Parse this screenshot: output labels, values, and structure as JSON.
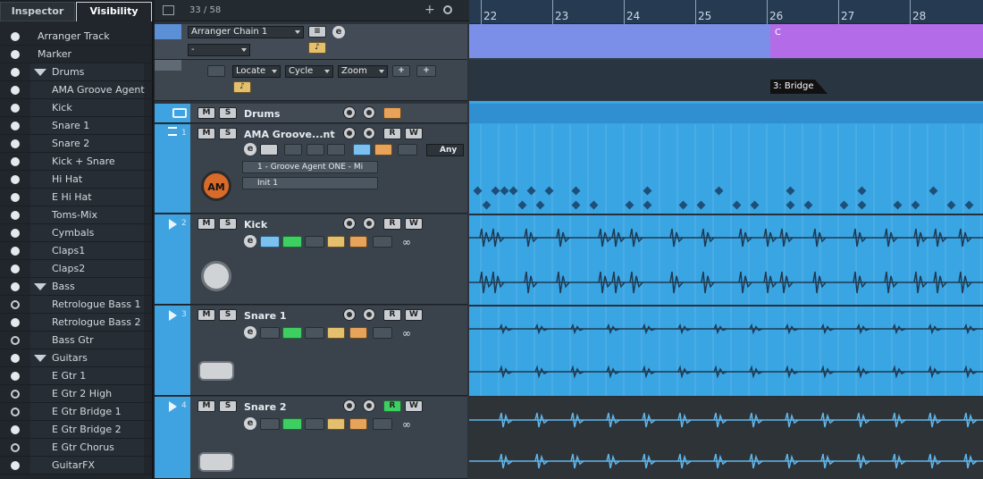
{
  "tabs": {
    "inspector": "Inspector",
    "visibility": "Visibility"
  },
  "visibility": [
    {
      "label": "Arranger Track",
      "level": 0,
      "dot": "filled"
    },
    {
      "label": "Marker",
      "level": 0,
      "dot": "filled"
    },
    {
      "label": "Drums",
      "level": 1,
      "dot": "filled",
      "folder": true
    },
    {
      "label": "AMA Groove Agent",
      "level": 2,
      "dot": "filled"
    },
    {
      "label": "Kick",
      "level": 2,
      "dot": "filled"
    },
    {
      "label": "Snare 1",
      "level": 2,
      "dot": "filled"
    },
    {
      "label": "Snare 2",
      "level": 2,
      "dot": "filled"
    },
    {
      "label": "Kick + Snare",
      "level": 2,
      "dot": "filled"
    },
    {
      "label": "Hi Hat",
      "level": 2,
      "dot": "filled"
    },
    {
      "label": "E Hi Hat",
      "level": 2,
      "dot": "filled"
    },
    {
      "label": "Toms-Mix",
      "level": 2,
      "dot": "filled"
    },
    {
      "label": "Cymbals",
      "level": 2,
      "dot": "filled"
    },
    {
      "label": "Claps1",
      "level": 2,
      "dot": "filled"
    },
    {
      "label": "Claps2",
      "level": 2,
      "dot": "filled"
    },
    {
      "label": "Bass",
      "level": 1,
      "dot": "filled",
      "folder": true
    },
    {
      "label": "Retrologue Bass 1",
      "level": 2,
      "dot": "hollow"
    },
    {
      "label": "Retrologue Bass 2",
      "level": 2,
      "dot": "filled"
    },
    {
      "label": "Bass Gtr",
      "level": 2,
      "dot": "hollow"
    },
    {
      "label": "Guitars",
      "level": 1,
      "dot": "filled",
      "folder": true
    },
    {
      "label": "E Gtr 1",
      "level": 2,
      "dot": "filled"
    },
    {
      "label": "E Gtr 2 High",
      "level": 2,
      "dot": "hollow"
    },
    {
      "label": "E Gtr Bridge 1",
      "level": 2,
      "dot": "hollow"
    },
    {
      "label": "E Gtr Bridge 2",
      "level": 2,
      "dot": "filled"
    },
    {
      "label": "E Gtr Chorus",
      "level": 2,
      "dot": "hollow"
    },
    {
      "label": "GuitarFX",
      "level": 2,
      "dot": "filled"
    }
  ],
  "header": {
    "track_count": "33 / 58",
    "plus": "+"
  },
  "arranger": {
    "chain": "Arranger Chain 1",
    "dash": "-"
  },
  "chain_row": {
    "locate": "Locate",
    "cycle": "Cycle",
    "zoom": "Zoom"
  },
  "tracks": {
    "drums": {
      "name": "Drums"
    },
    "ama": {
      "num": "1",
      "name": "AMA Groove...nt",
      "any": "Any",
      "instrument": "1 - Groove Agent ONE - Mi",
      "preset": "Init 1",
      "logo": "AM"
    },
    "kick": {
      "num": "2",
      "name": "Kick"
    },
    "snare1": {
      "num": "3",
      "name": "Snare 1"
    },
    "snare2": {
      "num": "4",
      "name": "Snare 2"
    }
  },
  "buttons": {
    "m": "M",
    "s": "S",
    "r": "R",
    "w": "W",
    "e": "e"
  },
  "ruler": {
    "bars": [
      "22",
      "23",
      "24",
      "25",
      "26",
      "27",
      "28"
    ]
  },
  "events": {
    "arranger_c": "C",
    "marker": "3: Bridge"
  },
  "colors": {
    "arranger_blue": "#7c8fe8",
    "arranger_purple": "#b46be8",
    "track_blue": "#3ea3e0",
    "lane_dark": "#2e3338"
  }
}
